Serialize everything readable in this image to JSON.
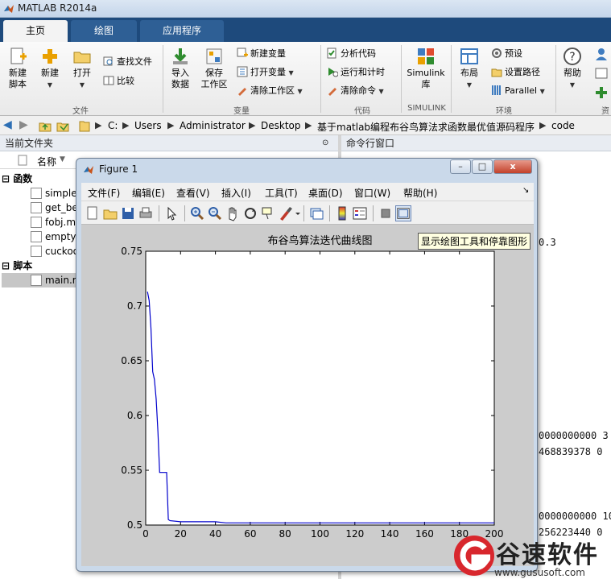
{
  "window": {
    "title": "MATLAB R2014a"
  },
  "ribbon_tabs": [
    {
      "label": "主页",
      "active": true
    },
    {
      "label": "绘图",
      "active": false
    },
    {
      "label": "应用程序",
      "active": false
    }
  ],
  "ribbon": {
    "new_script": "新建\n脚本",
    "new": "新建",
    "open": "打开",
    "find_files": "查找文件",
    "compare": "比较",
    "file_group": "文件",
    "import_data": "导入\n数据",
    "save_workspace": "保存\n工作区",
    "new_variable": "新建变量",
    "open_variable": "打开变量",
    "clear_workspace": "清除工作区",
    "variable_group": "变量",
    "analyze_code": "分析代码",
    "run_and_time": "运行和计时",
    "clear_commands": "清除命令",
    "code_group": "代码",
    "simulink_library": "Simulink\n库",
    "simulink_group": "SIMULINK",
    "layout": "布局",
    "preferences": "预设",
    "set_path": "设置路径",
    "parallel": "Parallel",
    "environment_group": "环境",
    "help": "帮助",
    "resources_group": "资"
  },
  "address": {
    "parts": [
      "C:",
      "Users",
      "Administrator",
      "Desktop",
      "基于matlab编程布谷鸟算法求函数最优值源码程序",
      "code"
    ]
  },
  "current_folder": {
    "title": "当前文件夹",
    "name_column": "名称",
    "functions_label": "函数",
    "functions": [
      "simple",
      "get_be",
      "fobj.m",
      "empty",
      "cuckoo"
    ],
    "scripts_label": "脚本",
    "scripts": [
      "main.r"
    ]
  },
  "command_window": {
    "title": "命令行窗口",
    "visible_fragments": [
      {
        "text": "0.3"
      },
      {
        "text": "0000000000   3"
      },
      {
        "text": "468839378   0"
      },
      {
        "text": "0000000000  10"
      },
      {
        "text": "256223440   0"
      }
    ]
  },
  "figure": {
    "title": "Figure 1",
    "controls": {
      "minimize": "–",
      "maximize": "□",
      "close": "x"
    },
    "menu": [
      "文件(F)",
      "编辑(E)",
      "查看(V)",
      "插入(I)",
      "工具(T)",
      "桌面(D)",
      "窗口(W)",
      "帮助(H)"
    ],
    "menu_arrow": "↘",
    "tooltip": "显示绘图工具和停靠图形",
    "toolbar_icons": [
      "new-figure-icon",
      "open-file-icon",
      "save-icon",
      "print-icon",
      "pointer-icon",
      "zoom-in-icon",
      "zoom-out-icon",
      "pan-icon",
      "rotate-icon",
      "data-cursor-icon",
      "brush-icon",
      "link-icon",
      "colorbar-icon",
      "legend-icon",
      "hide-plot-tools-icon",
      "show-plot-tools-icon"
    ]
  },
  "chart_data": {
    "type": "line",
    "title": "布谷鸟算法迭代曲线图",
    "xlabel": "",
    "ylabel": "",
    "xlim": [
      0,
      200
    ],
    "ylim": [
      0.5,
      0.75
    ],
    "xticks": [
      "0",
      "20",
      "40",
      "60",
      "80",
      "100",
      "120",
      "140",
      "160",
      "180",
      "200"
    ],
    "yticks": [
      "0.5",
      "0.55",
      "0.6",
      "0.65",
      "0.7",
      "0.75"
    ],
    "grid": false,
    "color": "#0000cc",
    "series": [
      {
        "x": [
          1,
          2,
          3,
          4,
          5,
          6,
          7,
          8,
          9,
          10,
          11,
          12,
          13,
          14,
          20,
          30,
          40,
          46,
          50,
          60,
          80,
          100,
          120,
          140,
          160,
          180,
          200
        ],
        "y": [
          0.713,
          0.705,
          0.68,
          0.64,
          0.633,
          0.615,
          0.585,
          0.548,
          0.548,
          0.548,
          0.548,
          0.548,
          0.505,
          0.504,
          0.503,
          0.503,
          0.503,
          0.502,
          0.502,
          0.502,
          0.502,
          0.502,
          0.502,
          0.502,
          0.502,
          0.502,
          0.502
        ]
      }
    ]
  },
  "watermark": {
    "brand": "谷速软件",
    "url": "www.gususoft.com"
  }
}
